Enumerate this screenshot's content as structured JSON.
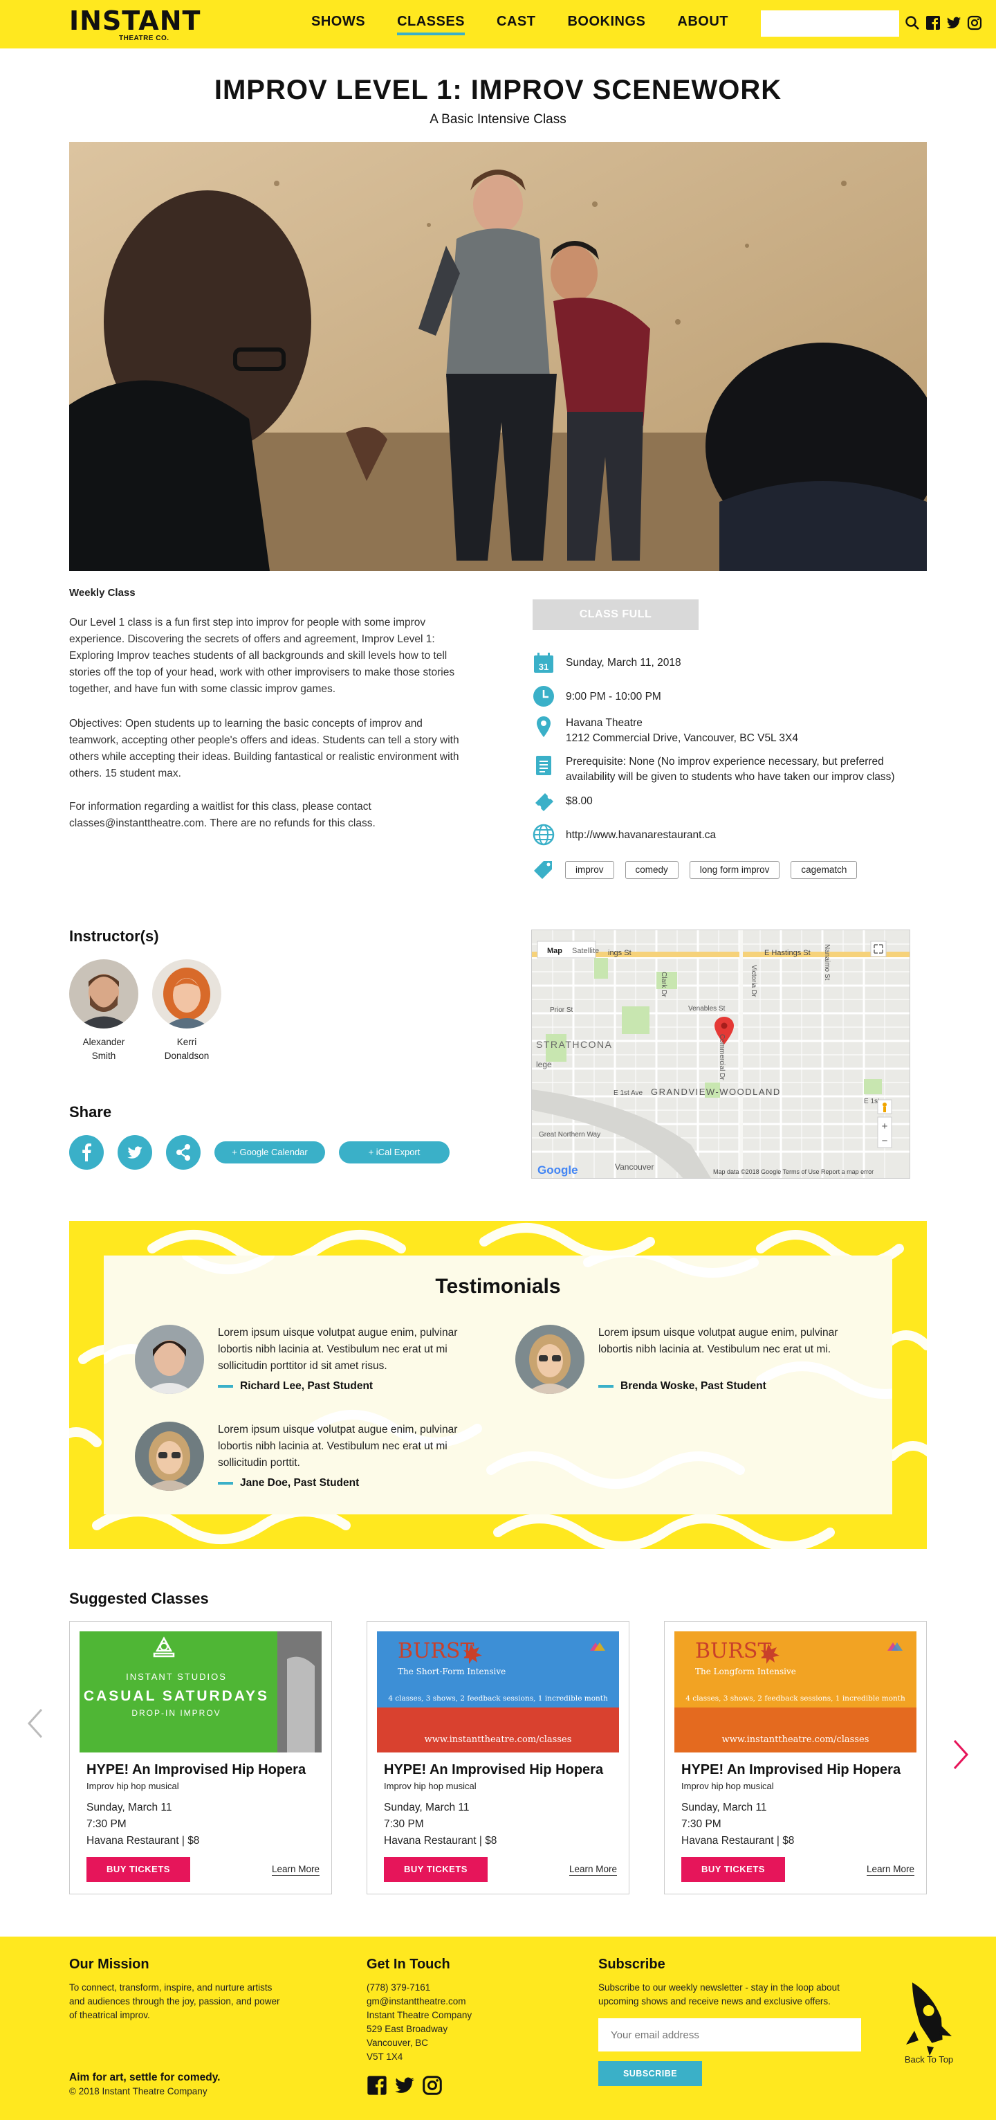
{
  "header": {
    "logo_text": "INSTANT",
    "logo_sub": "THEATRE CO.",
    "nav": [
      "SHOWS",
      "CLASSES",
      "CAST",
      "BOOKINGS",
      "ABOUT"
    ],
    "search_placeholder": ""
  },
  "page": {
    "title": "IMPROV LEVEL 1: IMPROV SCENEWORK",
    "subtitle": "A Basic Intensive Class"
  },
  "details": {
    "type_label": "Weekly Class",
    "description": "Our Level 1 class is a fun first step into improv for people with some improv experience. Discovering the secrets of offers and agreement, Improv Level 1: Exploring Improv teaches students of all backgrounds and skill levels how to tell stories off the top of your head, work with other improvisers to make those stories together, and have fun with some classic improv games.",
    "objectives": "Objectives: Open students up to learning the basic concepts of improv and teamwork, accepting other people's offers and ideas. Students can tell a story with others while accepting their ideas. Building fantastical or realistic environment with others. 15 student max.",
    "waitlist": "For information regarding a waitlist for this class, please contact classes@instanttheatre.com. There are no refunds for this class.",
    "class_full_label": "CLASS FULL",
    "date": "Sunday, March 11, 2018",
    "calendar_day": "31",
    "time": "9:00 PM - 10:00 PM",
    "venue": "Havana Theatre",
    "address": "1212 Commercial Drive, Vancouver, BC V5L 3X4",
    "prerequisite": "Prerequisite: None (No improv experience necessary, but preferred availability will be given to students who have taken our improv class)",
    "price": "$8.00",
    "website": "http://www.havanarestaurant.ca",
    "tags": [
      "improv",
      "comedy",
      "long form improv",
      "cagematch"
    ]
  },
  "instructors": {
    "heading": "Instructor(s)",
    "people": [
      {
        "name_first": "Alexander",
        "name_last": "Smith"
      },
      {
        "name_first": "Kerri",
        "name_last": "Donaldson"
      }
    ]
  },
  "share": {
    "heading": "Share",
    "google_label": "+ Google Calendar",
    "ical_label": "+ iCal Export"
  },
  "map": {
    "tab_map": "Map",
    "tab_satellite": "Satellite",
    "labels": [
      "E Hastings St",
      "ings St",
      "Venables St",
      "Prior St",
      "STRATHCONA",
      "lege",
      "GRANDVIEW-WOODLAND",
      "E 1st Ave",
      "E 1st",
      "Great Northern Way",
      "Vancouver",
      "Clark Dr",
      "Victoria Dr",
      "Nanaimo St",
      "Commercial Dr"
    ],
    "footer": "Map data ©2018 Google   Terms of Use   Report a map error",
    "google": "Google"
  },
  "testimonials": {
    "heading": "Testimonials",
    "items": [
      {
        "quote": "Lorem ipsum uisque volutpat augue enim, pulvinar lobortis nibh lacinia at. Vestibulum nec erat ut mi sollicitudin porttitor id sit amet risus.",
        "name": "Richard Lee, Past Student"
      },
      {
        "quote": "Lorem ipsum uisque volutpat augue enim, pulvinar lobortis nibh lacinia at. Vestibulum nec erat ut mi.",
        "name": "Brenda Woske, Past Student"
      },
      {
        "quote": "Lorem ipsum uisque volutpat augue enim, pulvinar lobortis nibh lacinia at. Vestibulum nec erat ut mi sollicitudin porttit.",
        "name": "Jane Doe, Past Student"
      }
    ]
  },
  "suggested": {
    "heading": "Suggested Classes",
    "cards": [
      {
        "img_top": "INSTANT STUDIOS",
        "img_main": "CASUAL SATURDAYS",
        "img_sub": "DROP-IN IMPROV",
        "title": "HYPE! An Improvised Hip Hopera",
        "subtitle": "Improv hip hop musical",
        "date": "Sunday, March 11",
        "time": "7:30 PM",
        "venue": "Havana Restaurant | $8",
        "buy": "BUY TICKETS",
        "learn": "Learn More"
      },
      {
        "img_main": "BURST",
        "img_sub": "The Short-Form Intensive",
        "img_line": "4 classes, 3 shows, 2 feedback sessions, 1 incredible month",
        "img_url": "www.instanttheatre.com/classes",
        "title": "HYPE! An Improvised Hip Hopera",
        "subtitle": "Improv hip hop musical",
        "date": "Sunday, March 11",
        "time": "7:30 PM",
        "venue": "Havana Restaurant | $8",
        "buy": "BUY TICKETS",
        "learn": "Learn More"
      },
      {
        "img_main": "BURST",
        "img_sub": "The Longform Intensive",
        "img_line": "4 classes, 3 shows, 2 feedback sessions, 1 incredible month",
        "img_url": "www.instanttheatre.com/classes",
        "title": "HYPE! An Improvised Hip Hopera",
        "subtitle": "Improv hip hop musical",
        "date": "Sunday, March 11",
        "time": "7:30 PM",
        "venue": "Havana Restaurant | $8",
        "buy": "BUY TICKETS",
        "learn": "Learn More"
      }
    ]
  },
  "footer": {
    "mission_heading": "Our Mission",
    "mission_text": "To connect, transform, inspire, and nurture artists and audiences through the joy, passion, and power of theatrical improv.",
    "tagline": "Aim for art, settle for comedy.",
    "copyright": "© 2018 Instant Theatre Company",
    "contact_heading": "Get In Touch",
    "phone": "(778) 379-7161",
    "email": "gm@instanttheatre.com",
    "company": "Instant Theatre Company",
    "street": "529 East Broadway",
    "city": "Vancouver, BC",
    "postal": "V5T 1X4",
    "subscribe_heading": "Subscribe",
    "subscribe_text": "Subscribe to our weekly newsletter - stay in the loop about upcoming shows and receive news and exclusive offers.",
    "email_placeholder": "Your email address",
    "subscribe_button": "SUBSCRIBE",
    "back_to_top": "Back To Top"
  },
  "colors": {
    "brand_yellow": "#ffe81f",
    "accent_teal": "#3ab0c8",
    "ticket_red": "#e6155a"
  }
}
